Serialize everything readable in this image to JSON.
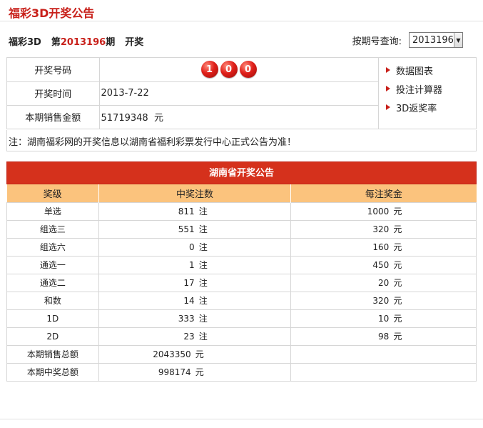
{
  "header": {
    "title": "福彩3D开奖公告"
  },
  "issue": {
    "game": "福彩3D",
    "prefix": "第",
    "number": "2013196",
    "suffix": "期",
    "action": "开奖"
  },
  "query": {
    "label": "按期号查询:",
    "selected": "2013196"
  },
  "draw_info": {
    "number_label": "开奖号码",
    "balls": [
      "1",
      "0",
      "0"
    ],
    "date_label": "开奖时间",
    "date": "2013-7-22",
    "sales_label": "本期销售金额",
    "sales": "51719348",
    "sales_unit": "元"
  },
  "side_links": [
    "数据图表",
    "投注计算器",
    "3D返奖率"
  ],
  "note": "注：湖南福彩网的开奖信息以湖南省福利彩票发行中心正式公告为准！",
  "prize": {
    "title": "湖南省开奖公告",
    "columns": [
      "奖级",
      "中奖注数",
      "每注奖金"
    ],
    "count_unit": "注",
    "money_unit": "元",
    "rows": [
      {
        "level": "单选",
        "count": "811",
        "amount": "1000"
      },
      {
        "level": "组选三",
        "count": "551",
        "amount": "320"
      },
      {
        "level": "组选六",
        "count": "0",
        "amount": "160"
      },
      {
        "level": "通选一",
        "count": "1",
        "amount": "450"
      },
      {
        "level": "通选二",
        "count": "17",
        "amount": "20"
      },
      {
        "level": "和数",
        "count": "14",
        "amount": "320"
      },
      {
        "level": "1D",
        "count": "333",
        "amount": "10"
      },
      {
        "level": "2D",
        "count": "23",
        "amount": "98"
      }
    ],
    "total_sales_label": "本期销售总额",
    "total_sales": "2043350",
    "total_prize_label": "本期中奖总额",
    "total_prize": "998174"
  }
}
